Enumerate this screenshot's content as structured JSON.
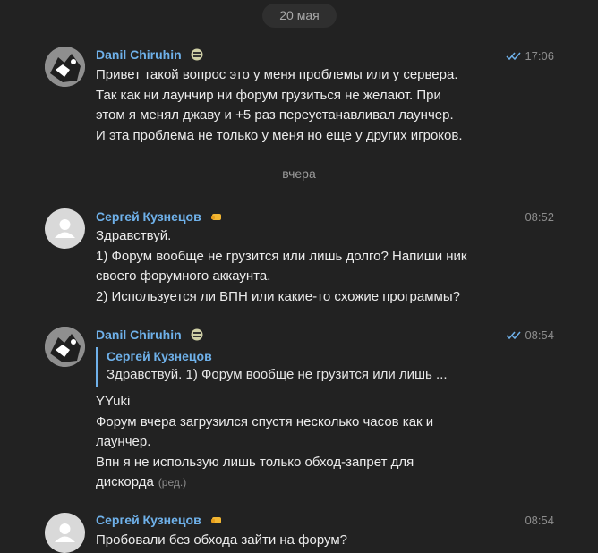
{
  "dates": {
    "first": "20 мая",
    "second": "вчера"
  },
  "messages": [
    {
      "author": "Danil Chiruhin",
      "time": "17:06",
      "read": true,
      "lines": [
        "Привет такой вопрос это у меня проблемы или у сервера.",
        "Так как ни лаунчир ни форум грузиться не желают. При",
        "этом я менял джаву и +5 раз переустанавливал лаунчер.",
        "И эта проблема не только у меня но еще у других игроков."
      ]
    },
    {
      "author": "Сергей Кузнецов",
      "time": "08:52",
      "lines": [
        "Здравствуй.",
        "1) Форум вообще не грузится или лишь долго? Напиши ник",
        "своего форумного аккаунта.",
        "2) Используется ли ВПН или какие-то схожие программы?"
      ]
    },
    {
      "author": "Danil Chiruhin",
      "time": "08:54",
      "read": true,
      "reply": {
        "author": "Сергей Кузнецов",
        "text": "Здравствуй. 1) Форум вообще не грузится или лишь ..."
      },
      "lines": [
        "YYuki",
        "Форум вчера загрузился спустя несколько часов  как и",
        "лаунчер.",
        "Впн я не использую лишь только обход-запрет для",
        "дискорда"
      ],
      "edited": "(ред.)"
    },
    {
      "author": "Сергей Кузнецов",
      "time": "08:54",
      "lines": [
        "Пробовали без обхода зайти на форум?"
      ]
    }
  ],
  "colors": {
    "background": "#222222",
    "author": "#6fb1ea",
    "text": "#ececec",
    "muted": "#8d8d8d"
  },
  "icons": {
    "read_status": "double-check-icon",
    "author_badge_1": "emoji-badge-icon",
    "author_badge_2": "fist-emoji-icon"
  }
}
